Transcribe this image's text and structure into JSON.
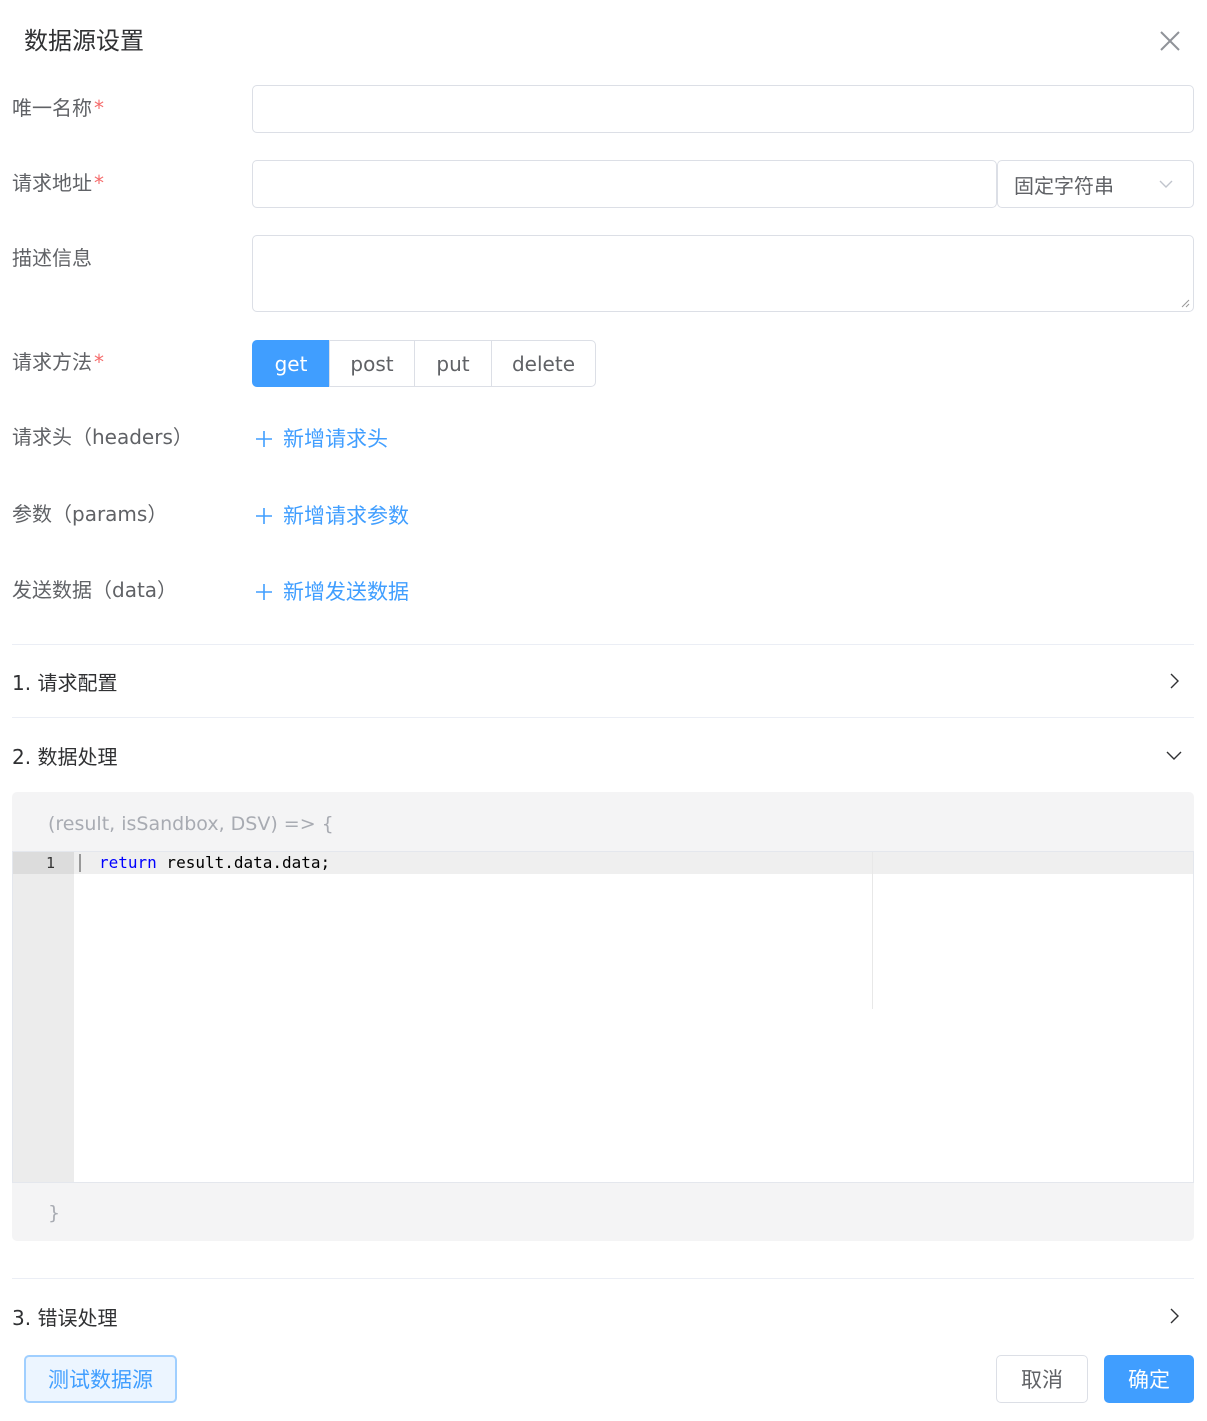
{
  "dialog": {
    "title": "数据源设置"
  },
  "form": {
    "name": {
      "label": "唯一名称",
      "required": "*",
      "value": ""
    },
    "url": {
      "label": "请求地址",
      "required": "*",
      "value": "",
      "mode": "固定字符串"
    },
    "description": {
      "label": "描述信息",
      "value": ""
    },
    "method": {
      "label": "请求方法",
      "required": "*",
      "options": [
        "get",
        "post",
        "put",
        "delete"
      ],
      "selected": "get"
    },
    "headers": {
      "label": "请求头（headers）",
      "add": "新增请求头"
    },
    "params": {
      "label": "参数（params）",
      "add": "新增请求参数"
    },
    "data": {
      "label": "发送数据（data）",
      "add": "新增发送数据"
    }
  },
  "sections": {
    "request_config": {
      "title": "1. 请求配置",
      "expanded": false
    },
    "data_handling": {
      "title": "2. 数据处理",
      "expanded": true
    },
    "error_handling": {
      "title": "3. 错误处理",
      "expanded": false
    }
  },
  "code": {
    "signature": "(result, isSandbox, DSV) => {",
    "line_number": "1",
    "keyword": "return",
    "rest": " result.data.data;",
    "closing": "}"
  },
  "footer": {
    "test_label": "测试数据源",
    "cancel_label": "取消",
    "ok_label": "确定"
  },
  "colors": {
    "primary": "#409eff",
    "required": "#f56c6c"
  }
}
